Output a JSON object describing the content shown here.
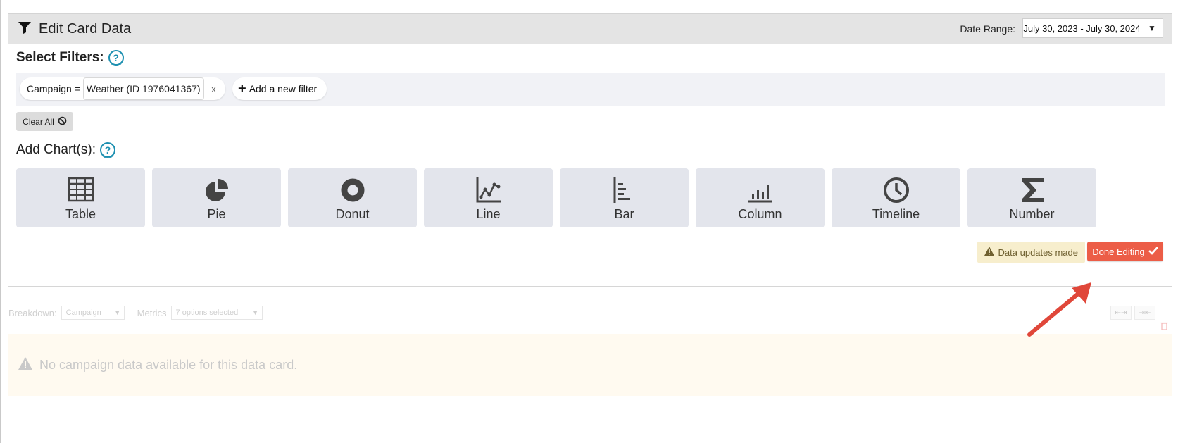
{
  "card": {
    "title": "Edit Card Data",
    "date_range_label": "Date Range:",
    "date_range_value": "July 30, 2023 - July 30, 2024"
  },
  "filters": {
    "title": "Select Filters:",
    "items": [
      {
        "field": "Campaign =",
        "value": "Weather (ID 1976041367)",
        "remove": "x"
      }
    ],
    "add_label": "Add a new filter",
    "clear_all_label": "Clear All"
  },
  "charts": {
    "title": "Add Chart(s):",
    "types": [
      {
        "label": "Table",
        "icon": "table-icon"
      },
      {
        "label": "Pie",
        "icon": "pie-chart-icon"
      },
      {
        "label": "Donut",
        "icon": "donut-chart-icon"
      },
      {
        "label": "Line",
        "icon": "line-chart-icon"
      },
      {
        "label": "Bar",
        "icon": "bar-chart-icon"
      },
      {
        "label": "Column",
        "icon": "column-chart-icon"
      },
      {
        "label": "Timeline",
        "icon": "clock-icon"
      },
      {
        "label": "Number",
        "icon": "sigma-icon"
      }
    ]
  },
  "status": {
    "message": "Data updates made",
    "done_label": "Done Editing"
  },
  "background": {
    "breakdown_label": "Breakdown:",
    "breakdown_value": "Campaign",
    "metrics_label": "Metrics",
    "metrics_value": "7 options selected",
    "empty_message": "No campaign data available for this data card."
  },
  "colors": {
    "accent": "#1b8fb0",
    "done_button": "#ec5d47",
    "warning_bg": "#f7eecd",
    "tile_bg": "#e3e5ec",
    "annotation_arrow": "#e0473a"
  }
}
